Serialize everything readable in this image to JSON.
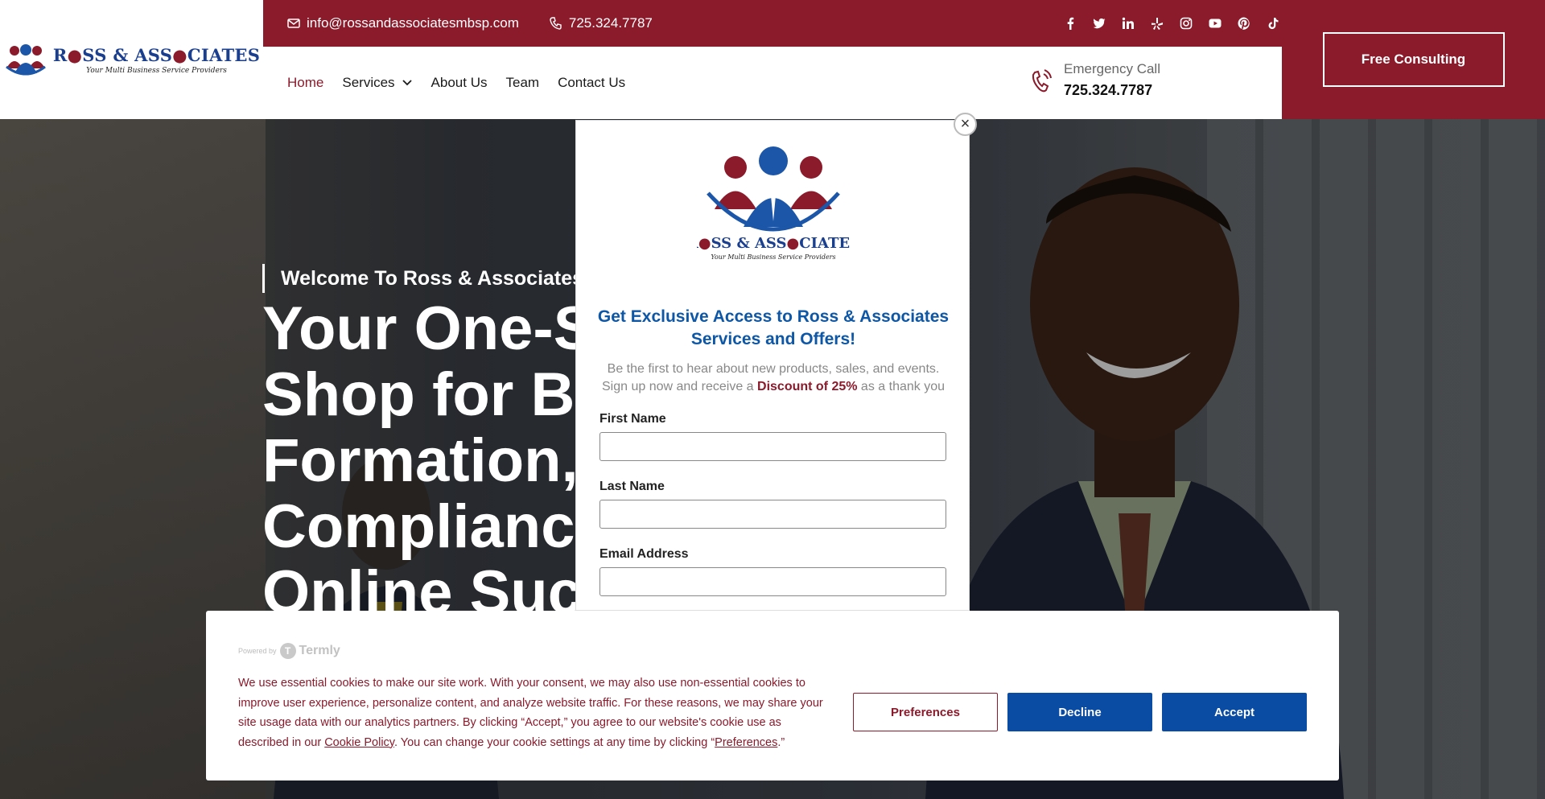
{
  "brand": {
    "name_part1": "R",
    "name_part2": "SS & ASS",
    "name_part3": "CIATES",
    "tagline": "Your Multi Business Service Providers"
  },
  "topbar": {
    "email": "info@rossandassociatesmbsp.com",
    "phone": "725.324.7787",
    "socials": [
      "facebook-icon",
      "twitter-icon",
      "linkedin-icon",
      "yelp-icon",
      "instagram-icon",
      "youtube-icon",
      "pinterest-icon",
      "tiktok-icon"
    ]
  },
  "nav": {
    "items": [
      {
        "label": "Home",
        "active": true
      },
      {
        "label": "Services",
        "dropdown": true
      },
      {
        "label": "About Us"
      },
      {
        "label": "Team"
      },
      {
        "label": "Contact Us"
      }
    ],
    "emergency_label": "Emergency Call",
    "emergency_number": "725.324.7787",
    "cta": "Free Consulting"
  },
  "hero": {
    "welcome": "Welcome To Ross & Associates",
    "headline": "Your One-S\nShop for B\nFormation,\nComplianc\nOnline Suc"
  },
  "popup": {
    "close": "×",
    "title": "Get Exclusive Access to Ross & Associates Services and Offers!",
    "desc_line1": "Be the first to hear about new products, sales, and events.",
    "desc_pre": "Sign up now and receive a ",
    "desc_discount": "Discount of 25%",
    "desc_post": " as a thank you",
    "fields": [
      {
        "label": "First Name",
        "value": ""
      },
      {
        "label": "Last Name",
        "value": ""
      },
      {
        "label": "Email Address",
        "value": ""
      }
    ]
  },
  "cookie": {
    "powered_by": "Powered by",
    "provider": "Termly",
    "text_1": "We use essential cookies to make our site work. With your consent, we may also use non-essential cookies to improve user experience, personalize content, and analyze website traffic. For these reasons, we may share your site usage data with our analytics partners. By clicking “Accept,” you agree to our website's cookie use as described in our ",
    "link_policy": "Cookie Policy",
    "text_2": ". You can change your cookie settings at any time by clicking “",
    "link_prefs": "Preferences",
    "text_3": ".”",
    "btn_preferences": "Preferences",
    "btn_decline": "Decline",
    "btn_accept": "Accept"
  },
  "colors": {
    "brand_red": "#8b1a2b",
    "brand_blue": "#0a4ca3",
    "title_blue": "#0d57a6"
  }
}
